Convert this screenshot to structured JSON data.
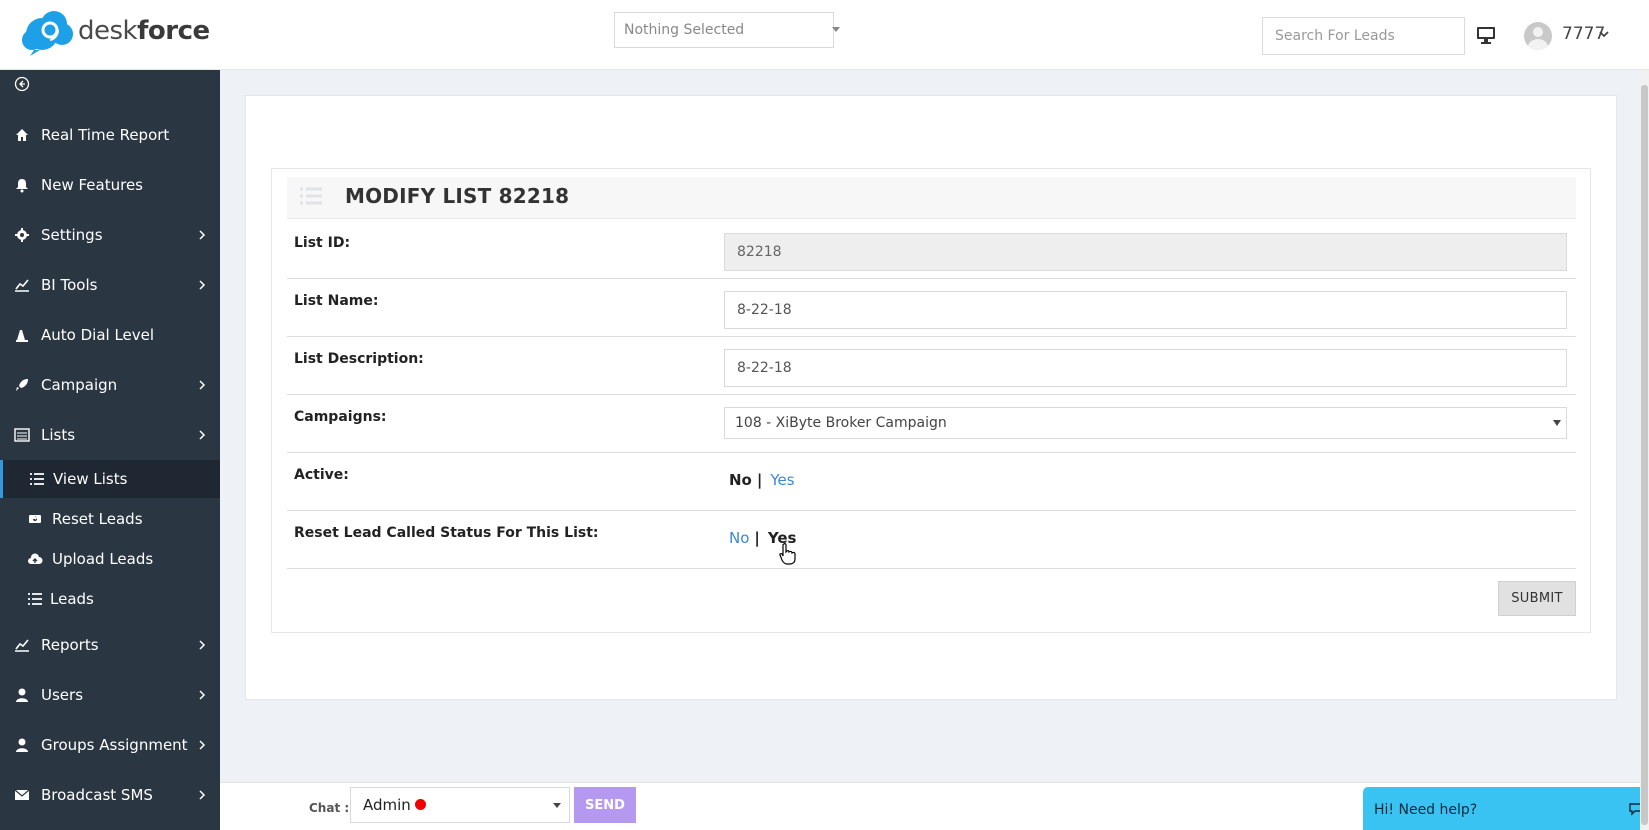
{
  "header": {
    "brand_light": "desk",
    "brand_bold": "force",
    "campaign_select": "Nothing Selected",
    "search_placeholder": "Search For Leads",
    "user_name": "7777"
  },
  "sidebar": {
    "items": [
      {
        "label": "Real Time Report",
        "icon": "home-icon"
      },
      {
        "label": "New Features",
        "icon": "bell-icon"
      },
      {
        "label": "Settings",
        "icon": "gear-icon"
      },
      {
        "label": "BI Tools",
        "icon": "chart-line-icon"
      },
      {
        "label": "Auto Dial Level",
        "icon": "dial-level-icon"
      },
      {
        "label": "Campaign",
        "icon": "rocket-icon"
      },
      {
        "label": "Lists",
        "icon": "list-alt-icon"
      },
      {
        "label": "Reports",
        "icon": "chart-line-icon"
      },
      {
        "label": "Users",
        "icon": "user-icon"
      },
      {
        "label": "Groups Assignment",
        "icon": "user-icon"
      },
      {
        "label": "Broadcast SMS",
        "icon": "envelope-icon"
      }
    ],
    "sub_items": [
      {
        "label": "View Lists",
        "icon": "list-icon"
      },
      {
        "label": "Reset Leads",
        "icon": "reset-icon"
      },
      {
        "label": "Upload Leads",
        "icon": "cloud-upload-icon"
      },
      {
        "label": "Leads",
        "icon": "list-icon"
      }
    ]
  },
  "form": {
    "title": "MODIFY LIST 82218",
    "list_id_label": "List ID:",
    "list_id_value": "82218",
    "list_name_label": "List Name:",
    "list_name_value": "8-22-18",
    "list_desc_label": "List Description:",
    "list_desc_value": "8-22-18",
    "campaigns_label": "Campaigns:",
    "campaigns_value": "108 - XiByte Broker Campaign",
    "active_label": "Active:",
    "active_no": "No",
    "active_sep": "|",
    "active_yes": "Yes",
    "reset_label": "Reset Lead Called Status For This List:",
    "reset_no": "No",
    "reset_sep": "|",
    "reset_yes": "Yes",
    "submit_label": "SUBMIT"
  },
  "chat": {
    "label": "Chat :",
    "selected": "Admin",
    "status_color": "#f00000",
    "send_label": "SEND"
  },
  "help": {
    "text": "Hi! Need help?"
  },
  "colors": {
    "sidebar_bg": "#2b3643",
    "accent_blue": "#3a87d6",
    "send_button": "#b599f0",
    "help_bg": "#38c3f2"
  }
}
